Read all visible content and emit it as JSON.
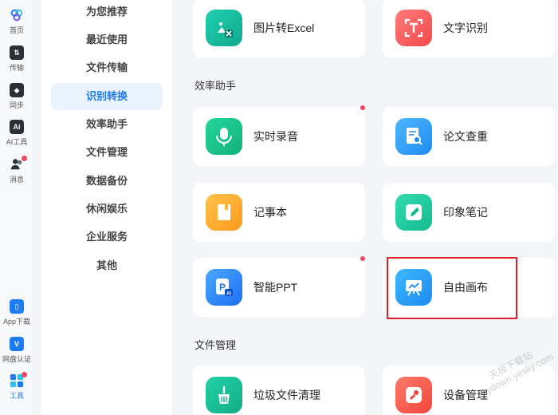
{
  "rail": {
    "top": [
      {
        "label": "首页",
        "icon": "home-icon"
      },
      {
        "label": "传输",
        "icon": "transfer-icon"
      },
      {
        "label": "同步",
        "icon": "sync-icon"
      },
      {
        "label": "AI工具",
        "icon": "ai-icon"
      },
      {
        "label": "消息",
        "icon": "message-icon"
      }
    ],
    "bottom": [
      {
        "label": "App下载",
        "icon": "phone-icon"
      },
      {
        "label": "网盘认证",
        "icon": "verify-icon"
      },
      {
        "label": "工具",
        "icon": "tools-icon"
      }
    ]
  },
  "categories": [
    "为您推荐",
    "最近使用",
    "文件传输",
    "识别转换",
    "效率助手",
    "文件管理",
    "数据备份",
    "休闲娱乐",
    "企业服务",
    "其他"
  ],
  "active_category": "识别转换",
  "sections": {
    "efficiency": "效率助手",
    "file_manage": "文件管理"
  },
  "cards": {
    "img_excel": "图片转Excel",
    "ocr": "文字识别",
    "recorder": "实时录音",
    "paper_check": "论文查重",
    "notebook": "记事本",
    "evernote": "印象笔记",
    "smart_ppt": "智能PPT",
    "canvas": "自由画布",
    "cleanup": "垃圾文件清理",
    "device_manage": "设备管理"
  },
  "watermark": {
    "line1": "天极下载站",
    "line2": "mydown.yesky.com"
  },
  "colors": {
    "accent": "#1e7cf2",
    "highlight": "#e0202a",
    "badge": "#f2455f"
  }
}
